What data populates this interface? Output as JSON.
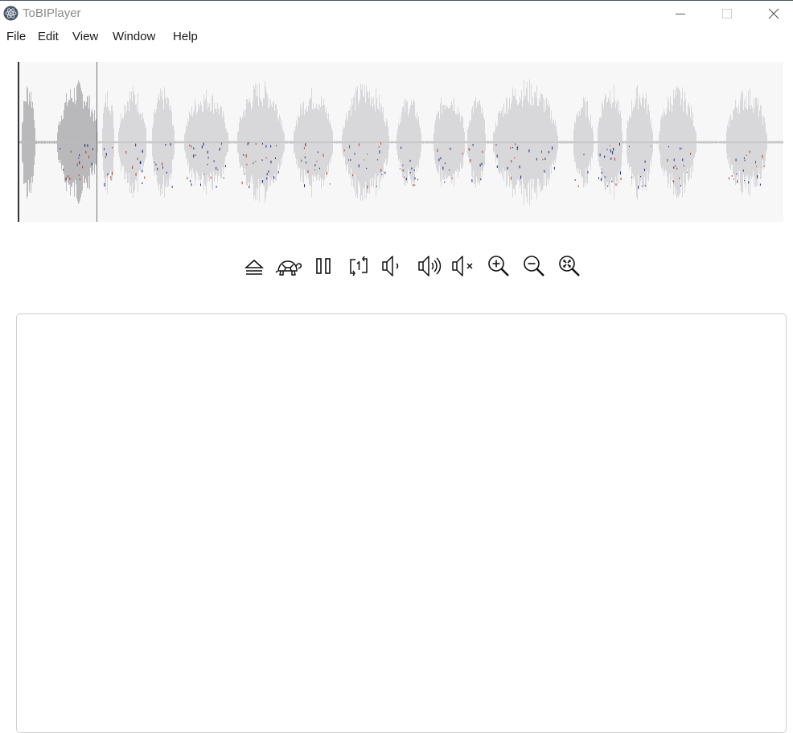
{
  "window": {
    "title": "ToBIPlayer",
    "controls": [
      {
        "name": "minimize-button",
        "icon": "minimize-icon"
      },
      {
        "name": "maximize-button",
        "icon": "maximize-icon"
      },
      {
        "name": "close-button",
        "icon": "close-icon"
      }
    ]
  },
  "menu": {
    "items": [
      "File",
      "Edit",
      "View",
      "Window",
      "Help"
    ]
  },
  "waveform": {
    "background_color": "#f7f7f8",
    "wave_color": "#d8d8da",
    "played_color": "#b9b9bb",
    "axis_color": "#bdbdbd",
    "cursor_color": "#777777",
    "pitch_colors": [
      "#1c2a7a",
      "#b2402a"
    ]
  },
  "toolbar": {
    "buttons": [
      {
        "name": "eject-button",
        "icon": "eject-icon"
      },
      {
        "name": "slow-playback-button",
        "icon": "turtle-icon"
      },
      {
        "name": "pause-button",
        "icon": "pause-icon"
      },
      {
        "name": "loop-button",
        "icon": "repeat-once-icon"
      },
      {
        "name": "volume-down-button",
        "icon": "volume-low-icon"
      },
      {
        "name": "volume-up-button",
        "icon": "volume-high-icon"
      },
      {
        "name": "mute-button",
        "icon": "volume-mute-icon"
      },
      {
        "name": "zoom-in-button",
        "icon": "zoom-in-icon"
      },
      {
        "name": "zoom-out-button",
        "icon": "zoom-out-icon"
      },
      {
        "name": "zoom-fit-button",
        "icon": "zoom-reset-icon"
      }
    ]
  },
  "annotation_panel": {
    "content": ""
  }
}
